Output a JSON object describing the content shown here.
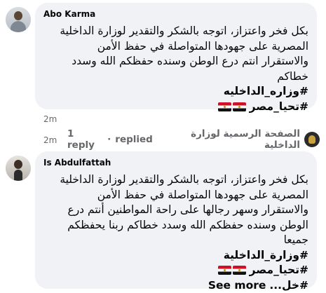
{
  "comments": [
    {
      "author": "Abo Karma",
      "lines": [
        "بكل فخر واعتزاز، اتوجه بالشكر والتقدير لوزارة الداخلية",
        "المصرية على جهودها المتواصلة في حفظ الأمن",
        "والاستقرار انتم درع الوطن وسنده حفظكم الله وسدد",
        "خطاكم"
      ],
      "hashtags": [
        "#وزاره_الداخليه",
        "#تحيا_مصر"
      ],
      "timestamp": "2m"
    },
    {
      "author": "Is Abdulfattah",
      "lines": [
        "بكل فخر واعتزاز، اتوجه بالشكر والتقدير لوزارة الداخلية",
        "المصرية على جهودها المتواصلة في حفظ الأمن",
        "والاستقرار وسهر رجالها على راحة المواطنين أنتم درع",
        "الوطن وسنده حفظكم الله وسدد خطاكم ربنا يحفظكم",
        "جميعا"
      ],
      "hashtags": [
        "#وزارة_الداخلية",
        "#تحيا_مصر"
      ],
      "truncated_text": "#خل...",
      "see_more": "See more"
    }
  ],
  "reply_summary": {
    "page_name": "الصفحة الرسمية لوزارة الداخلية",
    "replied_label": "replied",
    "separator": "·",
    "reply_count_label": "1 reply",
    "timestamp": "2m"
  },
  "colors": {
    "bubble": "#f0f2f5",
    "meta_text": "#65676b",
    "text": "#050505",
    "flag": [
      "#ce1126",
      "#ffffff",
      "#000000"
    ]
  }
}
